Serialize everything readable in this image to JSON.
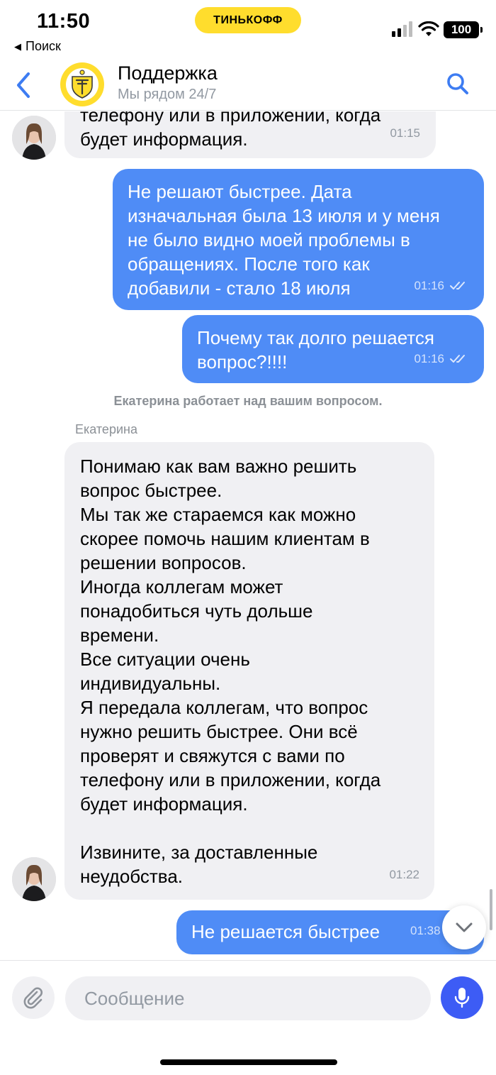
{
  "status_bar": {
    "time": "11:50",
    "back_app": "Поиск",
    "brand": "ТИНЬКОФФ",
    "battery": "100"
  },
  "header": {
    "title": "Поддержка",
    "subtitle": "Мы рядом 24/7"
  },
  "messages": [
    {
      "direction": "in",
      "text": "телефону или в приложении, когда\nбудет информация.",
      "time": "01:15"
    },
    {
      "direction": "out",
      "text": "Не решают быстрее. Дата\nизначальная была 13 июля и у меня\nне было видно моей проблемы в\nобращениях. После того как\nдобавили - стало 18 июля",
      "time": "01:16"
    },
    {
      "direction": "out",
      "text": "Почему так долго решается\nвопрос?!!!!",
      "time": "01:16"
    },
    {
      "direction": "in",
      "text": "Понимаю как вам важно решить\nвопрос быстрее.\nМы так же стараемся как можно\nскорее помочь нашим клиентам в\nрешении вопросов.\nИногда коллегам может\nпонадобиться чуть дольше\nвремени.\nВсе ситуации очень\nиндивидуальны.\nЯ передала коллегам, что вопрос\nнужно решить быстрее. Они всё\nпроверят и свяжутся с вами по\nтелефону или в приложении, когда\nбудет информация.\n\nИзвините, за доставленные\nнеудобства.",
      "time": "01:22"
    },
    {
      "direction": "out",
      "text": "Не решается быстрее",
      "time": "01:38"
    }
  ],
  "system_note": "Екатерина работает над вашим вопросом.",
  "agent_name": "Екатерина",
  "composer": {
    "placeholder": "Сообщение"
  },
  "colors": {
    "brand_yellow": "#ffdd2d",
    "outgoing_bubble": "#4f8cf6",
    "incoming_bubble": "#f0f0f3",
    "accent_blue": "#3d5cf5",
    "nav_blue": "#3d7cf2"
  }
}
